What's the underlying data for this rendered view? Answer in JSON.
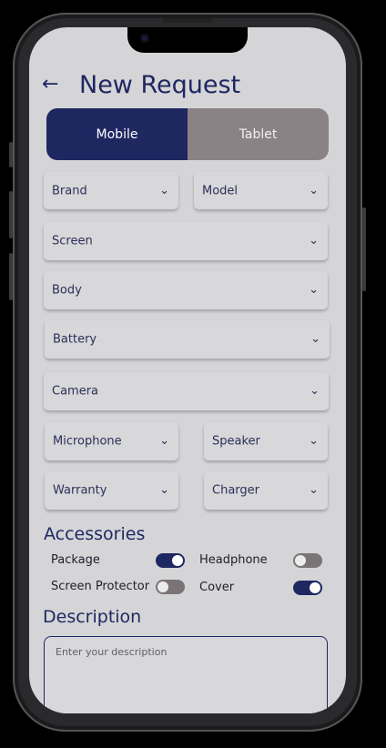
{
  "header": {
    "back_icon": "arrow-left-icon",
    "title": "New Request"
  },
  "device_type": {
    "options": [
      "Mobile",
      "Tablet"
    ],
    "selected": "Mobile"
  },
  "dropdowns": {
    "brand": "Brand",
    "model": "Model",
    "screen": "Screen",
    "body": "Body",
    "battery": "Battery",
    "camera": "Camera",
    "microphone": "Microphone",
    "speaker": "Speaker",
    "warranty": "Warranty",
    "charger": "Charger",
    "chevron": "⌄"
  },
  "accessories": {
    "title": "Accessories",
    "items": [
      {
        "label": "Package",
        "on": true
      },
      {
        "label": "Headphone",
        "on": false
      },
      {
        "label": "Screen Protector",
        "on": false
      },
      {
        "label": "Cover",
        "on": true
      }
    ]
  },
  "description": {
    "title": "Description",
    "placeholder": "Enter your description"
  },
  "colors": {
    "primary": "#1f2761",
    "inactive_segment": "#8a8284",
    "background": "#d5d5d8"
  }
}
